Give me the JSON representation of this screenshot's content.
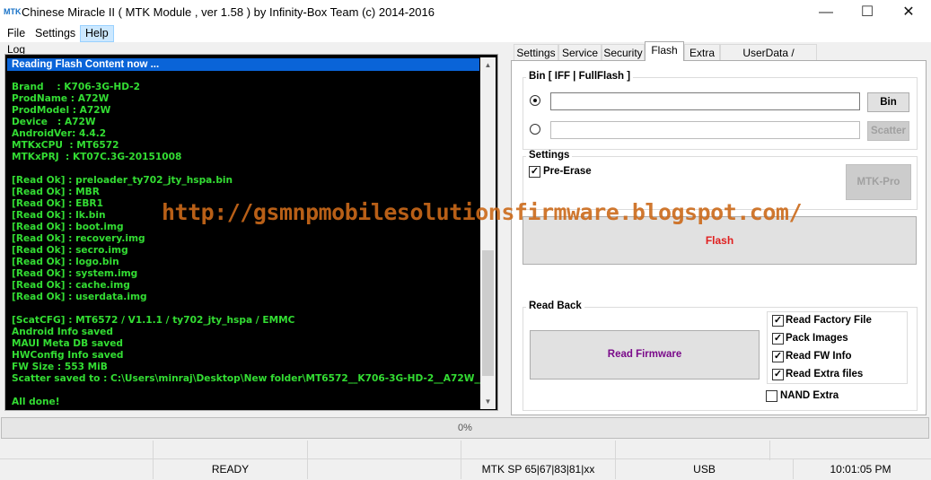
{
  "window": {
    "logo_text": "MTK",
    "title": "Chinese Miracle II ( MTK Module , ver 1.58 ) by Infinity-Box Team (c) 2014-2016",
    "minimize": "—",
    "maximize": "☐",
    "close": "✕"
  },
  "menu": {
    "file": "File",
    "settings": "Settings",
    "help": "Help"
  },
  "log": {
    "label": "Log",
    "header": "Reading Flash Content now ...",
    "lines": [
      "",
      "Brand    : K706-3G-HD-2",
      "ProdName : A72W",
      "ProdModel : A72W",
      "Device   : A72W",
      "AndroidVer: 4.4.2",
      "MTKxCPU  : MT6572",
      "MTKxPRJ  : KT07C.3G-20151008",
      "",
      "[Read Ok] : preloader_ty702_jty_hspa.bin",
      "[Read Ok] : MBR",
      "[Read Ok] : EBR1",
      "[Read Ok] : lk.bin",
      "[Read Ok] : boot.img",
      "[Read Ok] : recovery.img",
      "[Read Ok] : secro.img",
      "[Read Ok] : logo.bin",
      "[Read Ok] : system.img",
      "[Read Ok] : cache.img",
      "[Read Ok] : userdata.img",
      "",
      "[ScatCFG] : MT6572 / V1.1.1 / ty702_jty_hspa / EMMC",
      "Android Info saved",
      "MAUI Meta DB saved",
      "HWConfig Info saved",
      "FW Size : 553 MiB",
      "Scatter saved to : C:\\Users\\minraj\\Desktop\\New folder\\MT6572__K706-3G-HD-2__A72W__A",
      "",
      "All done!"
    ],
    "scroll_up": "▲",
    "scroll_down": "▼"
  },
  "watermark": "http://gsmnpmobilesolutionsfirmware.blogspot.com/",
  "tabs": [
    "Settings",
    "Service",
    "Security",
    "Flash",
    "Extra",
    "UserData / Forensic"
  ],
  "flash": {
    "bin_group_title": "Bin  [ IFF | FullFlash ]",
    "bin_path": "",
    "scatter_path": "",
    "bin_button": "Bin",
    "scatter_button": "Scatter",
    "settings_group_title": "Settings",
    "pre_erase_label": "Pre-Erase",
    "pre_erase_checked": true,
    "mtk_pro_button": "MTK-Pro",
    "flash_button": "Flash",
    "readback_group_title": "Read Back",
    "read_firmware_button": "Read Firmware",
    "options": [
      {
        "label": "Read Factory File",
        "checked": true
      },
      {
        "label": "Pack Images",
        "checked": true
      },
      {
        "label": "Read FW Info",
        "checked": true
      },
      {
        "label": "Read Extra files",
        "checked": true
      }
    ],
    "nand_extra_label": "NAND Extra",
    "nand_extra_checked": false,
    "check_mark": "✓"
  },
  "progress": {
    "label": "0%",
    "percent": 0
  },
  "colors": {
    "log_text": "#33dd33",
    "log_header": "#0a64d8",
    "flash_label": "#e02020",
    "read_firmware_label": "#7a0a8a",
    "watermark": "#cc6a1a"
  },
  "status": {
    "state": "READY",
    "chip": "MTK SP 65|67|83|81|xx",
    "port": "USB",
    "time": "10:01:05 PM"
  }
}
